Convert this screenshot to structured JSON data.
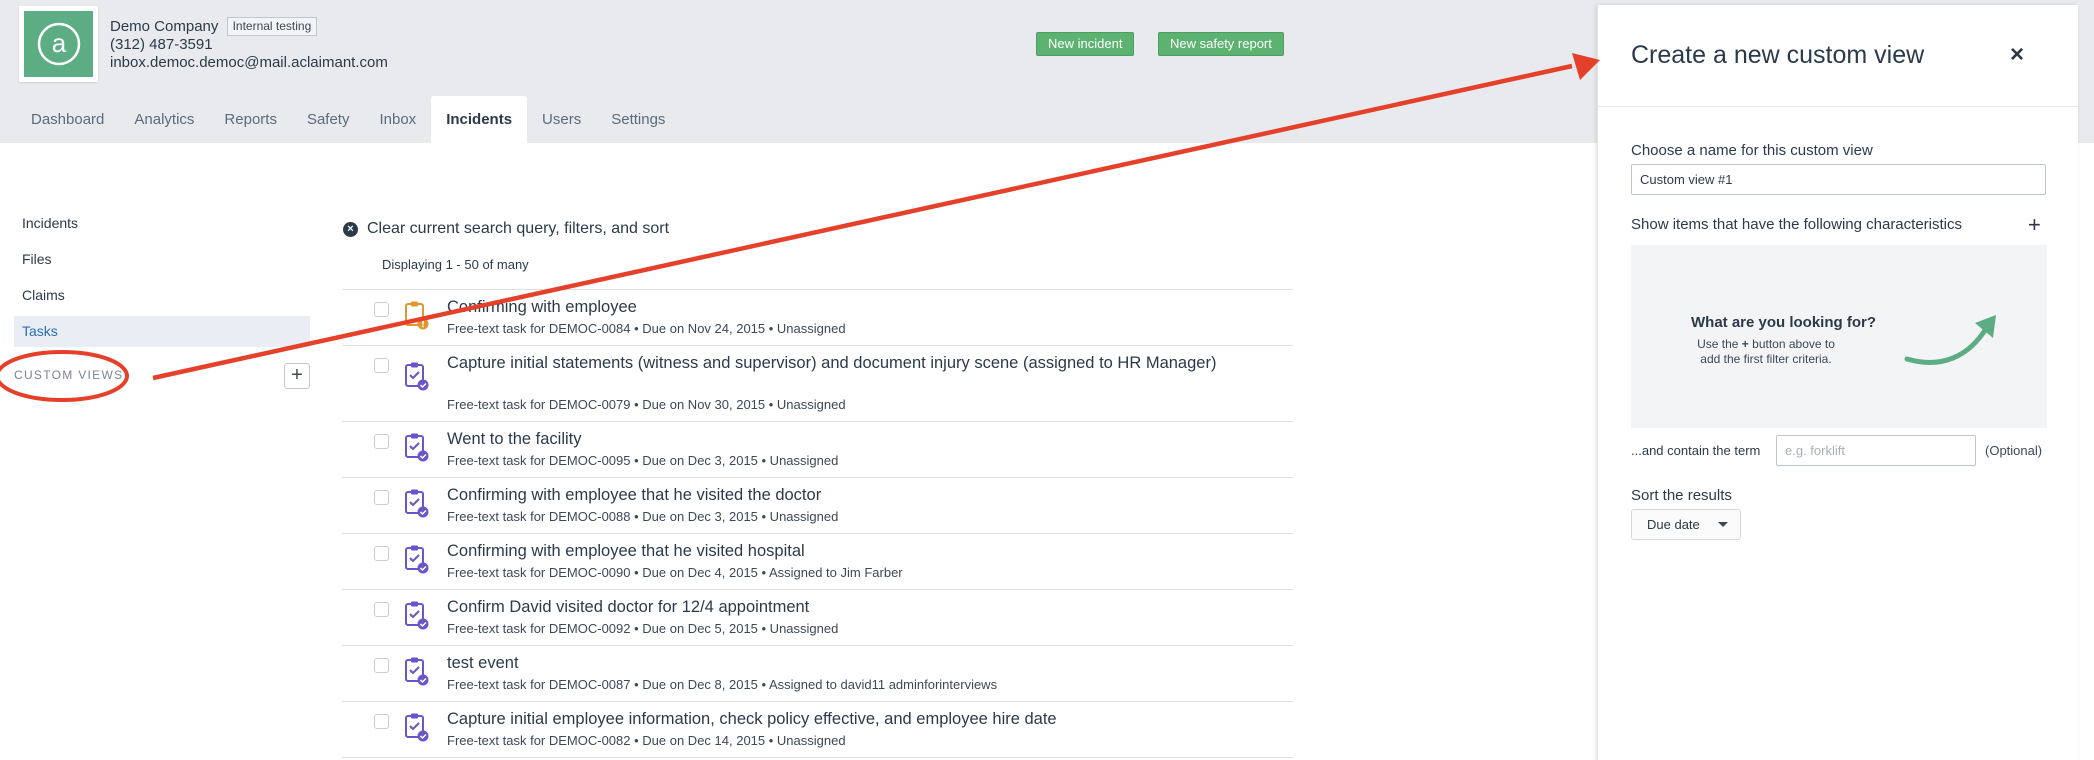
{
  "header": {
    "company_name": "Demo Company",
    "badge": "Internal testing",
    "phone": "(312) 487-3591",
    "email": "inbox.democ.democ@mail.aclaimant.com",
    "new_incident_label": "New incident",
    "new_safety_report_label": "New safety report",
    "logo_glyph": "a",
    "brand_color": "#5cad84"
  },
  "nav": {
    "tabs": [
      {
        "label": "Dashboard"
      },
      {
        "label": "Analytics"
      },
      {
        "label": "Reports"
      },
      {
        "label": "Safety"
      },
      {
        "label": "Inbox"
      },
      {
        "label": "Incidents"
      },
      {
        "label": "Users"
      },
      {
        "label": "Settings"
      }
    ],
    "active": "Incidents"
  },
  "sidebar": {
    "items": [
      {
        "label": "Incidents"
      },
      {
        "label": "Files"
      },
      {
        "label": "Claims"
      },
      {
        "label": "Tasks"
      }
    ],
    "active": "Tasks",
    "custom_views_label": "CUSTOM VIEWS",
    "add_label": "+"
  },
  "main": {
    "clear_label": "Clear current search query, filters, and sort",
    "displaying": "Displaying 1 - 50 of many",
    "tasks": [
      {
        "title": "Confirming with employee",
        "meta": "Free-text task for DEMOC-0084  •  Due on Nov 24, 2015  •  Unassigned",
        "status": "warning"
      },
      {
        "title": "Capture initial statements (witness and supervisor) and document injury scene (assigned to HR Manager)",
        "meta": "Free-text task for DEMOC-0079  •  Due on Nov 30, 2015  •  Unassigned",
        "status": "done"
      },
      {
        "title": "Went to the facility",
        "meta": "Free-text task for DEMOC-0095  •  Due on Dec 3, 2015  •  Unassigned",
        "status": "done"
      },
      {
        "title": "Confirming with employee that he visited the doctor",
        "meta": "Free-text task for DEMOC-0088  •  Due on Dec 3, 2015  •  Unassigned",
        "status": "done"
      },
      {
        "title": "Confirming with employee that he visited hospital",
        "meta": "Free-text task for DEMOC-0090  •  Due on Dec 4, 2015  •  Assigned to Jim Farber",
        "status": "done"
      },
      {
        "title": "Confirm David visited doctor for 12/4 appointment",
        "meta": "Free-text task for DEMOC-0092  •  Due on Dec 5, 2015  •  Unassigned",
        "status": "done"
      },
      {
        "title": "test event",
        "meta": "Free-text task for DEMOC-0087  •  Due on Dec 8, 2015  •  Assigned to david11 adminforinterviews",
        "status": "done"
      },
      {
        "title": "Capture initial employee information, check policy effective, and employee hire date",
        "meta": "Free-text task for DEMOC-0082  •  Due on Dec 14, 2015  •  Unassigned",
        "status": "done"
      }
    ]
  },
  "panel": {
    "title": "Create a new custom view",
    "close": "×",
    "name_label": "Choose a name for this custom view",
    "name_value": "Custom view #1",
    "characteristics_label": "Show items that have the following characteristics",
    "add_criteria": "+",
    "empty_title": "What are you looking for?",
    "empty_sub_pre": "Use the",
    "empty_sub_plus": "+",
    "empty_sub_post": "button above to add the first filter criteria.",
    "contain_label": "...and contain the term",
    "term_placeholder": "e.g. forklift",
    "optional": "(Optional)",
    "sort_label": "Sort the results",
    "sort_value": "Due date"
  },
  "colors": {
    "accent_blue": "#2d6db1",
    "task_purple": "#6b55c8",
    "task_warning": "#e1962f",
    "annotation_red": "#e5402a",
    "button_green": "#5cb370"
  }
}
